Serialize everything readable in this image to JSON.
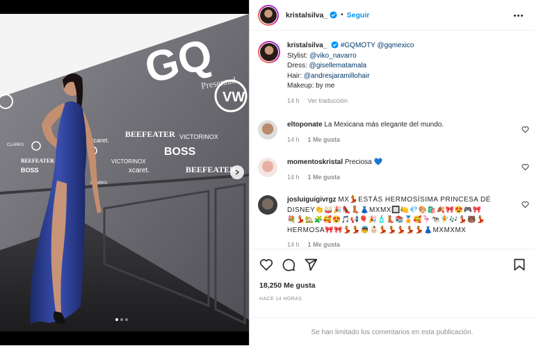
{
  "header": {
    "username": "kristalsilva_",
    "separator": "•",
    "follow_label": "Seguir"
  },
  "caption": {
    "username": "kristalsilva_",
    "text": "#GQMOTY @gqmexico",
    "lines": [
      {
        "label": "Stylist: ",
        "mention": "@viko_navarro"
      },
      {
        "label": "Dress: ",
        "mention": "@gisellematamala"
      },
      {
        "label": "Hair: ",
        "mention": "@andresjaramillohair"
      },
      {
        "label": "Makeup: by me",
        "mention": ""
      }
    ],
    "time": "14 h",
    "translate_label": "Ver traducción"
  },
  "comments": [
    {
      "username": "eltoponate",
      "text": "La Mexicana más elegante del mundo.",
      "time": "14 h",
      "likes": "1 Me gusta"
    },
    {
      "username": "momentoskristal",
      "text": "Preciosa 💙",
      "time": "14 h",
      "likes": "1 Me gusta"
    },
    {
      "username": "josluiguigivrgz",
      "text": "MX💃ESTÁS HERMOSÍSIMA PRINCESA DÉ DISNEY👏🥁🎉👠👢👗MXMX🔲🍋💎🎨🛍️🍂🎀😍🎮🎀",
      "text2": "💐💃🏡🧩🥰😍🎵📢🎈🎉🧴👢📚🏅🥰🦩🐄🧚🎶💃🏻🐻💃",
      "text3": "HERMOSA🎀🎀💃💃👼👶🏻💃💃💃💃💃👗MXMXMX",
      "time": "14 h",
      "likes": "1 Me gusta"
    }
  ],
  "likes_count": "18,250 Me gusta",
  "time_ago": "HACE 14 HORAS",
  "comments_limited": "Se han limitado los comentarios en esta publicación.",
  "photo_text": {
    "gq": "GQ",
    "presented": "Presentad",
    "boss": "BOSS",
    "beefeater": "BEEFEATER",
    "victorinox": "VICTORINOX",
    "xcaret": "xcaret.",
    "clarks": "CLARKS"
  },
  "colors": {
    "accent": "#0095f6",
    "dress": "#22347e",
    "wall": "#67676c"
  }
}
